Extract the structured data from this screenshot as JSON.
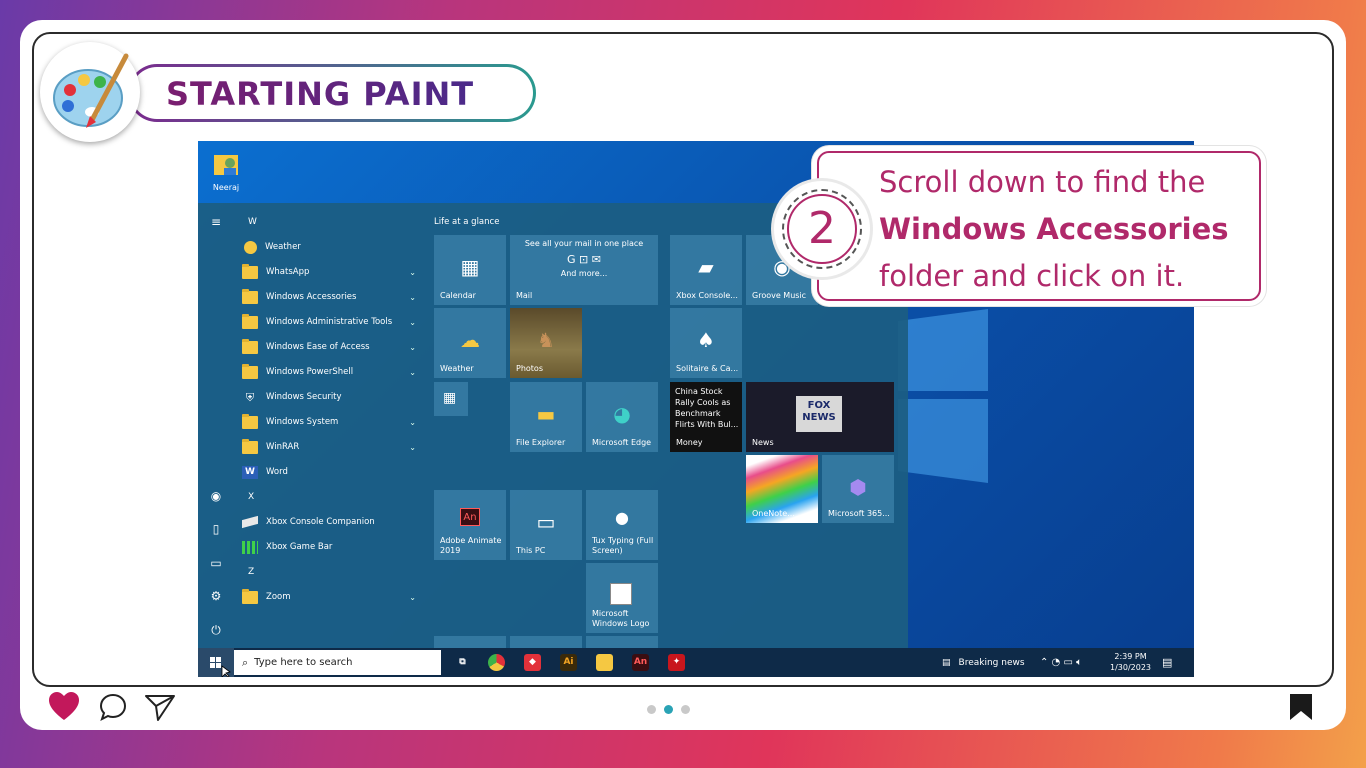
{
  "header": {
    "title": "STARTING PAINT",
    "logo_icon": "paint-palette-icon"
  },
  "callout": {
    "step_number": "2",
    "line1": "Scroll down to find the",
    "line2_bold": "Windows Accessories",
    "line3": "folder and click on it."
  },
  "desktop": {
    "icon_label": "Neeraj"
  },
  "start_menu": {
    "section_title": "Life at a glance",
    "letter_w": "W",
    "letter_x": "X",
    "letter_z": "Z",
    "apps": [
      {
        "label": "Weather",
        "icon": "weather-icon",
        "expandable": false
      },
      {
        "label": "WhatsApp",
        "icon": "folder-icon",
        "expandable": true
      },
      {
        "label": "Windows Accessories",
        "icon": "folder-icon",
        "expandable": true
      },
      {
        "label": "Windows Administrative Tools",
        "icon": "folder-icon",
        "expandable": true
      },
      {
        "label": "Windows Ease of Access",
        "icon": "folder-icon",
        "expandable": true
      },
      {
        "label": "Windows PowerShell",
        "icon": "folder-icon",
        "expandable": true
      },
      {
        "label": "Windows Security",
        "icon": "shield-icon",
        "expandable": false
      },
      {
        "label": "Windows System",
        "icon": "folder-icon",
        "expandable": true
      },
      {
        "label": "WinRAR",
        "icon": "folder-icon",
        "expandable": true
      },
      {
        "label": "Word",
        "icon": "word-icon",
        "expandable": false
      }
    ],
    "apps_x": [
      {
        "label": "Xbox Console Companion",
        "icon": "xbox-console-icon"
      },
      {
        "label": "Xbox Game Bar",
        "icon": "xbox-game-bar-icon"
      }
    ],
    "apps_z": [
      {
        "label": "Zoom",
        "icon": "folder-icon"
      }
    ],
    "tiles": {
      "calendar": "Calendar",
      "mail_head": "See all your mail in one place",
      "mail_more": "And more...",
      "mail": "Mail",
      "xbox": "Xbox Console...",
      "groove": "Groove Music",
      "weather": "Weather",
      "photos": "Photos",
      "solitaire": "Solitaire & Ca...",
      "file_explorer": "File Explorer",
      "edge": "Microsoft Edge",
      "money_text": "China Stock Rally Cools as Benchmark Flirts With Bul...",
      "money": "Money",
      "news": "News",
      "onenote": "OneNote...",
      "m365": "Microsoft 365...",
      "animate": "Adobe Animate 2019",
      "thispc": "This PC",
      "tux": "Tux Typing (Full Screen)",
      "winlogo": "Microsoft Windows Logo"
    }
  },
  "taskbar": {
    "search_placeholder": "Type here to search",
    "news": "Breaking news",
    "time": "2:39 PM",
    "date": "1/30/2023"
  },
  "colors": {
    "accent": "#b0296a",
    "title_gradient_start": "#7b2a8e",
    "title_gradient_end": "#2a9a8f",
    "active_dot": "#2aa3b5"
  }
}
